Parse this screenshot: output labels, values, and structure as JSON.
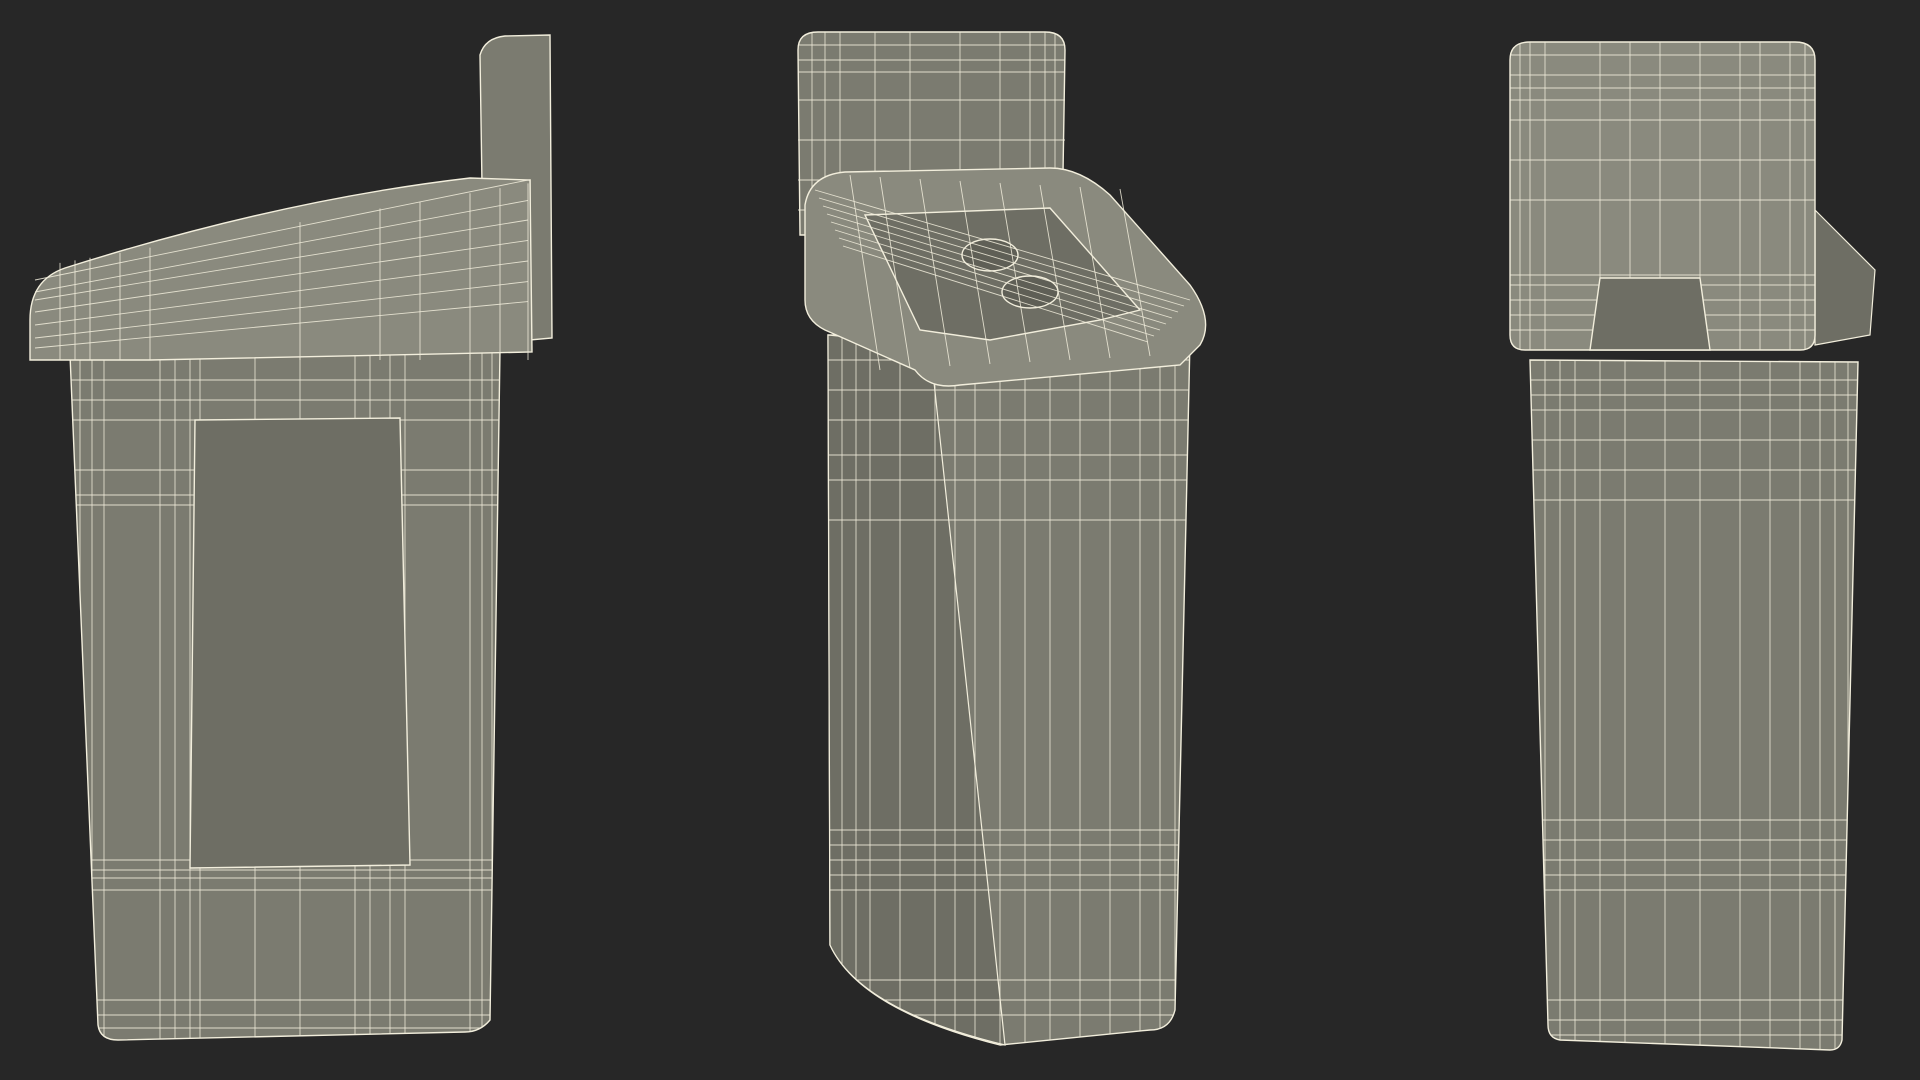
{
  "scene": {
    "background": "#272727",
    "model_fill": "#7b7b70",
    "model_shade": "#6e6e64",
    "model_light": "#8a8a7e",
    "wire_color": "#f2eedc",
    "views": [
      {
        "name": "left-side-view"
      },
      {
        "name": "three-quarter-view"
      },
      {
        "name": "rear-view"
      }
    ]
  }
}
